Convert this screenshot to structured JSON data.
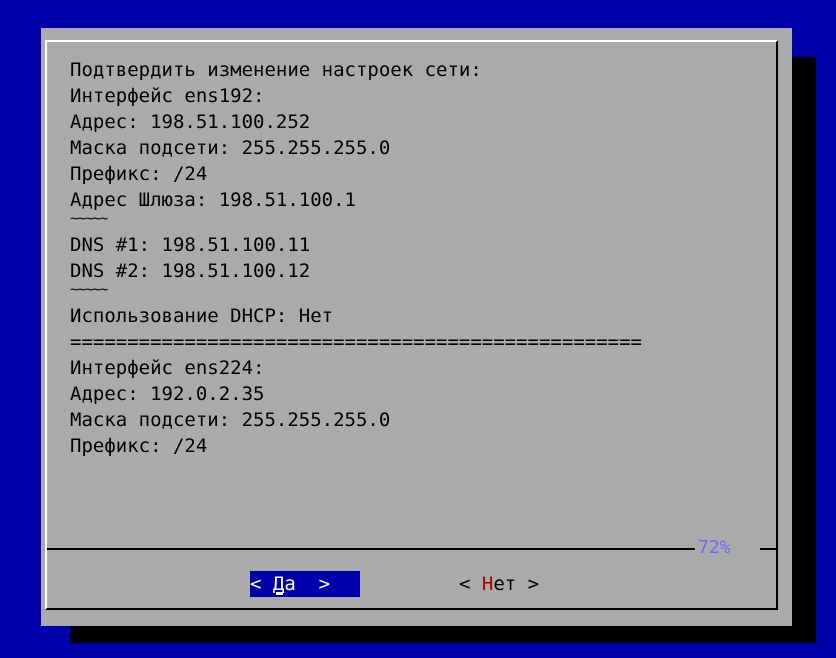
{
  "dialog": {
    "lines_group1": [
      "Подтвердить изменение настроек сети:",
      "Интерфейс ens192:",
      "Адрес: 198.51.100.252",
      "Маска подсети: 255.255.255.0",
      "Префикс: /24",
      "Адрес Шлюза: 198.51.100.1"
    ],
    "tilde_1": "~~~~~",
    "lines_group2": [
      "DNS #1: 198.51.100.11",
      "DNS #2: 198.51.100.12"
    ],
    "tilde_2": "~~~~~",
    "dhcp_line": "Использование DHCP: Нет",
    "separator": "==================================================",
    "lines_group3": [
      "Интерфейс ens224:",
      "Адрес: 192.0.2.35",
      "Маска подсети: 255.255.255.0",
      "Префикс: /24"
    ],
    "scroll_percent": "72%"
  },
  "buttons": {
    "yes": {
      "left": "< ",
      "hotkey": "Д",
      "rest": "а",
      "right": "  >"
    },
    "no": {
      "left": "< ",
      "hotkey": "Н",
      "rest": "ет",
      "right": " >"
    }
  },
  "colors": {
    "background": "#0000aa",
    "dialog": "#aaaaaa",
    "selected_button": "#0000aa",
    "hotkey": "#aa0000",
    "scroll_percent": "#6a6af5"
  }
}
